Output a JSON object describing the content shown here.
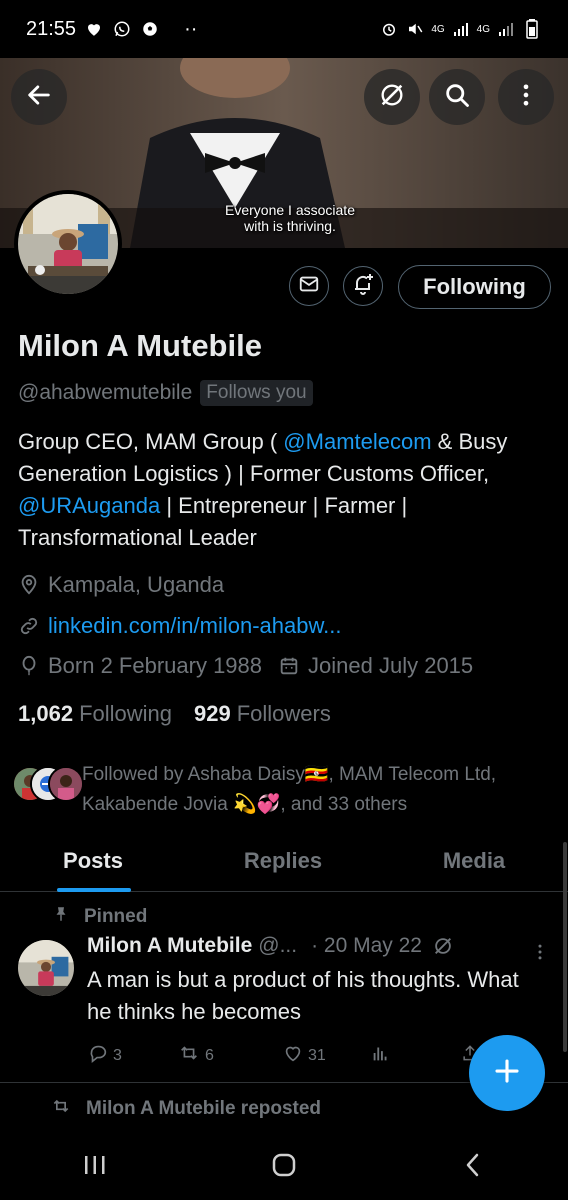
{
  "status_bar": {
    "time": "21:55",
    "dots": "··",
    "net1": "4G",
    "net2": "4G"
  },
  "banner": {
    "caption_line1": "Everyone I associate",
    "caption_line2": "with is thriving."
  },
  "profile": {
    "name": "Milon A Mutebile",
    "handle": "@ahabwemutebile",
    "follows_you": "Follows you",
    "following_button": "Following",
    "bio": {
      "p1": "Group CEO, MAM Group ( ",
      "mention1": "@Mamtelecom",
      "p2": " & Busy Generation Logistics ) | Former Customs Officer, ",
      "mention2": "@URAuganda",
      "p3": " | Entrepreneur | Farmer | Transformational Leader"
    },
    "location": "Kampala, Uganda",
    "website": "linkedin.com/in/milon-ahabw...",
    "born": "Born 2 February 1988",
    "joined": "Joined July 2015",
    "following_count": "1,062",
    "following_label": "Following",
    "followers_count": "929",
    "followers_label": "Followers",
    "followed_by": "Followed by Ashaba Daisy🇺🇬, MAM Telecom Ltd, Kakabende Jovia 💫💞, and 33 others"
  },
  "tabs": [
    "Posts",
    "Replies",
    "Media"
  ],
  "pinned_label": "Pinned",
  "tweet": {
    "name": "Milon A Mutebile",
    "handle": "@...",
    "date": "· 20 May 22",
    "text": "A man is but a product of his thoughts. What he thinks he becomes",
    "replies": "3",
    "reposts": "6",
    "likes": "31"
  },
  "reposted_label": "Milon A Mutebile reposted",
  "colors": {
    "accent": "#1d9bf0",
    "muted": "#71767b",
    "text": "#e7e9ea",
    "background": "#000000"
  },
  "icons": [
    "back-arrow-icon",
    "grok-icon",
    "search-icon",
    "more-vertical-icon",
    "mail-icon",
    "bell-plus-icon",
    "location-icon",
    "link-icon",
    "balloon-icon",
    "calendar-icon",
    "pin-icon",
    "reply-icon",
    "repost-icon",
    "like-icon",
    "views-icon",
    "plus-icon"
  ]
}
